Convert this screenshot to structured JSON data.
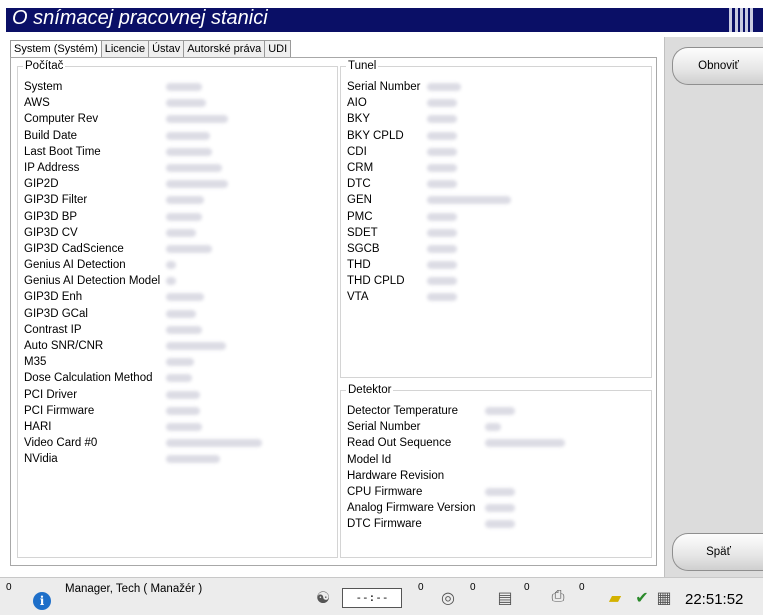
{
  "window": {
    "title": "O snímacej pracovnej stanici"
  },
  "tabs": [
    {
      "label": "System (Systém)",
      "active": true
    },
    {
      "label": "Licencie"
    },
    {
      "label": "Ústav"
    },
    {
      "label": "Autorské práva"
    },
    {
      "label": "UDI"
    }
  ],
  "pocitac": {
    "title": "Počítač",
    "rows": [
      "System",
      "AWS",
      "Computer Rev",
      "Build Date",
      "Last Boot Time",
      "IP Address",
      "GIP2D",
      "GIP3D Filter",
      "GIP3D BP",
      "GIP3D CV",
      "GIP3D CadScience",
      "Genius AI Detection",
      "Genius AI Detection Model",
      "GIP3D Enh",
      "GIP3D GCal",
      "Contrast IP",
      "Auto SNR/CNR",
      "M35",
      "Dose Calculation Method",
      "PCI Driver",
      "PCI Firmware",
      "HARI",
      "Video Card #0",
      "NVidia"
    ]
  },
  "tunel": {
    "title": "Tunel",
    "rows": [
      "Serial Number",
      "AIO",
      "BKY",
      "BKY CPLD",
      "CDI",
      "CRM",
      "DTC",
      "GEN",
      "PMC",
      "SDET",
      "SGCB",
      "THD",
      "THD CPLD",
      "VTA"
    ]
  },
  "detektor": {
    "title": "Detektor",
    "rows": [
      "Detector Temperature",
      "Serial Number",
      "Read Out Sequence",
      "Model Id",
      "Hardware Revision",
      "CPU Firmware",
      "Analog Firmware Version",
      "DTC Firmware"
    ]
  },
  "sidebar": {
    "refresh_label": "Obnoviť",
    "back_label": "Späť"
  },
  "statusbar": {
    "alert_count": "0",
    "user": "Manager, Tech ( Manažér )",
    "timer": "--:--",
    "counts": [
      "0",
      "0",
      "0",
      "0"
    ],
    "time": "22:51:52"
  }
}
